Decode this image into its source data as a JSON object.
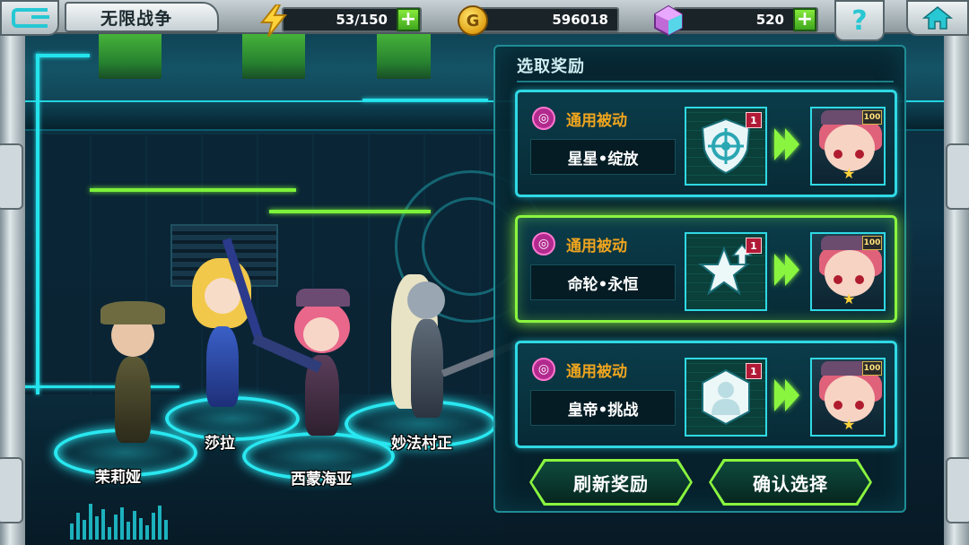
{
  "header": {
    "title": "无限战争",
    "energy": "53/150",
    "gold": "596018",
    "gems": "520",
    "help_glyph": "?",
    "coin_glyph": "G"
  },
  "characters": [
    {
      "name": "茉莉娅"
    },
    {
      "name": "莎拉"
    },
    {
      "name": "西蒙海亚"
    },
    {
      "name": "妙法村正"
    }
  ],
  "reward_panel": {
    "title": "选取奖励",
    "rewards": [
      {
        "type_label": "通用被动",
        "skill_name": "星星•绽放",
        "skill_level": "1",
        "hero_level": "100",
        "selected": false
      },
      {
        "type_label": "通用被动",
        "skill_name": "命轮•永恒",
        "skill_level": "1",
        "hero_level": "100",
        "selected": true
      },
      {
        "type_label": "通用被动",
        "skill_name": "皇帝•挑战",
        "skill_level": "1",
        "hero_level": "100",
        "selected": false
      }
    ],
    "refresh_button": "刷新奖励",
    "confirm_button": "确认选择"
  },
  "colors": {
    "accent_cyan": "#2fd9e4",
    "accent_green": "#8af53f",
    "label_orange": "#f0a51e"
  },
  "icons": [
    "back-icon",
    "energy-bolt-icon",
    "gold-coin-icon",
    "gem-icon",
    "help-icon",
    "home-icon",
    "passive-skill-icon",
    "target-shield-icon",
    "star-up-icon",
    "emperor-icon",
    "upgrade-arrow-icon"
  ]
}
